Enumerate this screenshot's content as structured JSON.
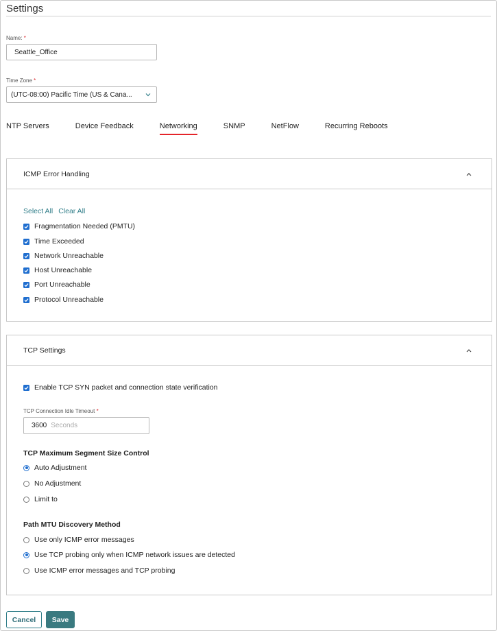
{
  "page": {
    "title": "Settings"
  },
  "name_field": {
    "label": "Name:",
    "required": "*",
    "value": "Seattle_Office"
  },
  "timezone_field": {
    "label": "Time Zone",
    "required": "*",
    "value": "(UTC-08:00) Pacific Time (US & Cana..."
  },
  "tabs": [
    {
      "label": "NTP Servers",
      "active": false
    },
    {
      "label": "Device Feedback",
      "active": false
    },
    {
      "label": "Networking",
      "active": true
    },
    {
      "label": "SNMP",
      "active": false
    },
    {
      "label": "NetFlow",
      "active": false
    },
    {
      "label": "Recurring Reboots",
      "active": false
    }
  ],
  "icmp": {
    "title": "ICMP Error Handling",
    "select_all": "Select All",
    "clear_all": "Clear All",
    "items": [
      {
        "label": "Fragmentation Needed (PMTU)",
        "checked": true
      },
      {
        "label": "Time Exceeded",
        "checked": true
      },
      {
        "label": "Network Unreachable",
        "checked": true
      },
      {
        "label": "Host Unreachable",
        "checked": true
      },
      {
        "label": "Port Unreachable",
        "checked": true
      },
      {
        "label": "Protocol Unreachable",
        "checked": true
      }
    ]
  },
  "tcp": {
    "title": "TCP Settings",
    "syn_check": {
      "label": "Enable TCP SYN packet and connection state verification",
      "checked": true
    },
    "idle_timeout": {
      "label": "TCP Connection Idle Timeout",
      "required": "*",
      "value": "3600",
      "unit": "Seconds"
    },
    "mss": {
      "title": "TCP Maximum Segment Size Control",
      "options": [
        {
          "label": "Auto Adjustment",
          "selected": true
        },
        {
          "label": "No Adjustment",
          "selected": false
        },
        {
          "label": "Limit to",
          "selected": false
        }
      ]
    },
    "pmtu": {
      "title": "Path MTU Discovery Method",
      "options": [
        {
          "label": "Use only ICMP error messages",
          "selected": false
        },
        {
          "label": "Use TCP probing only when ICMP network issues are detected",
          "selected": true
        },
        {
          "label": "Use ICMP error messages and TCP probing",
          "selected": false
        }
      ]
    }
  },
  "buttons": {
    "cancel": "Cancel",
    "save": "Save"
  },
  "colors": {
    "accent": "#2f7d88",
    "checkbox": "#1f6ecf",
    "tab_underline": "#e4242a",
    "required": "#d9262b"
  }
}
